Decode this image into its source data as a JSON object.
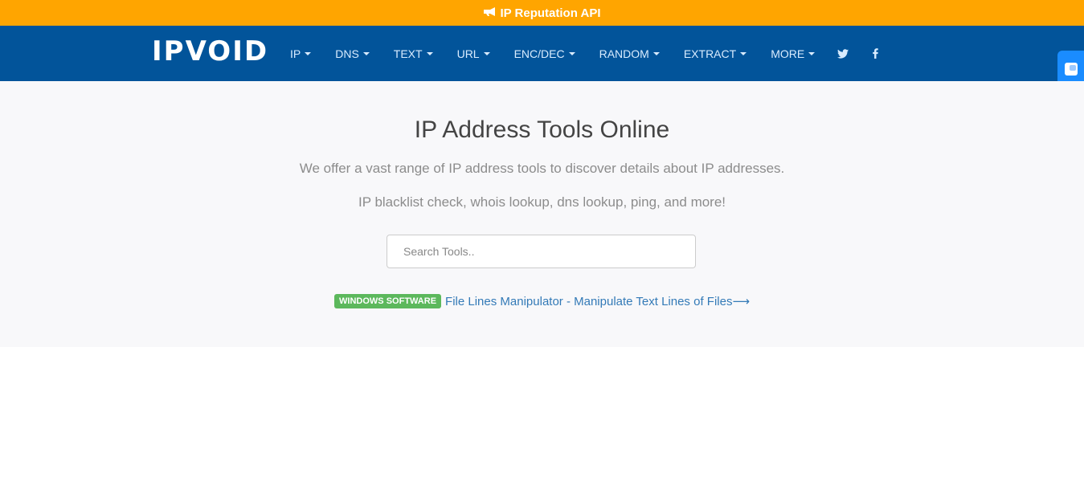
{
  "topbar": {
    "icon": "megaphone-icon",
    "label": "IP Reputation API"
  },
  "brand": "IPVOID",
  "nav": [
    {
      "label": "IP"
    },
    {
      "label": "DNS"
    },
    {
      "label": "TEXT"
    },
    {
      "label": "URL"
    },
    {
      "label": "ENC/DEC"
    },
    {
      "label": "RANDOM"
    },
    {
      "label": "EXTRACT"
    },
    {
      "label": "MORE"
    }
  ],
  "social": {
    "twitter": "twitter-icon",
    "facebook": "facebook-icon"
  },
  "hero": {
    "title": "IP Address Tools Online",
    "subtitle1": "We offer a vast range of IP address tools to discover details about IP addresses.",
    "subtitle2": "IP blacklist check, whois lookup, dns lookup, ping, and more!",
    "search_placeholder": "Search Tools..",
    "search_value": ""
  },
  "promo": {
    "badge": "WINDOWS SOFTWARE",
    "link": "File Lines Manipulator - Manipulate Text Lines of Files⟶"
  },
  "colors": {
    "topbar": "#ffa500",
    "navbar": "#02549a",
    "hero_bg": "#f8f8fa",
    "badge": "#5cb85c",
    "link": "#337ab7",
    "side_widget": "#1a8cff"
  }
}
